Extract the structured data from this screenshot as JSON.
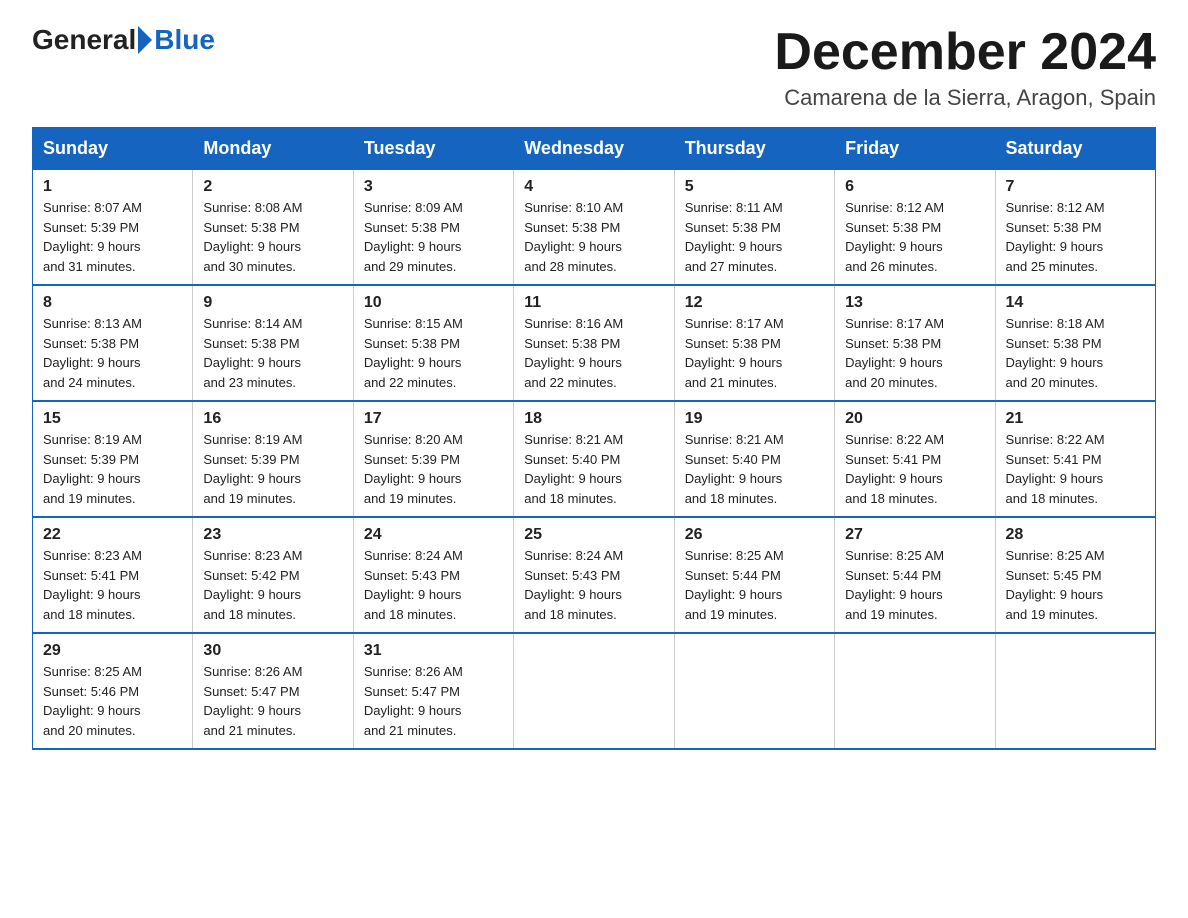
{
  "header": {
    "logo_general": "General",
    "logo_blue": "Blue",
    "month_title": "December 2024",
    "location": "Camarena de la Sierra, Aragon, Spain"
  },
  "weekdays": [
    "Sunday",
    "Monday",
    "Tuesday",
    "Wednesday",
    "Thursday",
    "Friday",
    "Saturday"
  ],
  "weeks": [
    [
      {
        "day": "1",
        "sunrise": "8:07 AM",
        "sunset": "5:39 PM",
        "daylight": "9 hours and 31 minutes."
      },
      {
        "day": "2",
        "sunrise": "8:08 AM",
        "sunset": "5:38 PM",
        "daylight": "9 hours and 30 minutes."
      },
      {
        "day": "3",
        "sunrise": "8:09 AM",
        "sunset": "5:38 PM",
        "daylight": "9 hours and 29 minutes."
      },
      {
        "day": "4",
        "sunrise": "8:10 AM",
        "sunset": "5:38 PM",
        "daylight": "9 hours and 28 minutes."
      },
      {
        "day": "5",
        "sunrise": "8:11 AM",
        "sunset": "5:38 PM",
        "daylight": "9 hours and 27 minutes."
      },
      {
        "day": "6",
        "sunrise": "8:12 AM",
        "sunset": "5:38 PM",
        "daylight": "9 hours and 26 minutes."
      },
      {
        "day": "7",
        "sunrise": "8:12 AM",
        "sunset": "5:38 PM",
        "daylight": "9 hours and 25 minutes."
      }
    ],
    [
      {
        "day": "8",
        "sunrise": "8:13 AM",
        "sunset": "5:38 PM",
        "daylight": "9 hours and 24 minutes."
      },
      {
        "day": "9",
        "sunrise": "8:14 AM",
        "sunset": "5:38 PM",
        "daylight": "9 hours and 23 minutes."
      },
      {
        "day": "10",
        "sunrise": "8:15 AM",
        "sunset": "5:38 PM",
        "daylight": "9 hours and 22 minutes."
      },
      {
        "day": "11",
        "sunrise": "8:16 AM",
        "sunset": "5:38 PM",
        "daylight": "9 hours and 22 minutes."
      },
      {
        "day": "12",
        "sunrise": "8:17 AM",
        "sunset": "5:38 PM",
        "daylight": "9 hours and 21 minutes."
      },
      {
        "day": "13",
        "sunrise": "8:17 AM",
        "sunset": "5:38 PM",
        "daylight": "9 hours and 20 minutes."
      },
      {
        "day": "14",
        "sunrise": "8:18 AM",
        "sunset": "5:38 PM",
        "daylight": "9 hours and 20 minutes."
      }
    ],
    [
      {
        "day": "15",
        "sunrise": "8:19 AM",
        "sunset": "5:39 PM",
        "daylight": "9 hours and 19 minutes."
      },
      {
        "day": "16",
        "sunrise": "8:19 AM",
        "sunset": "5:39 PM",
        "daylight": "9 hours and 19 minutes."
      },
      {
        "day": "17",
        "sunrise": "8:20 AM",
        "sunset": "5:39 PM",
        "daylight": "9 hours and 19 minutes."
      },
      {
        "day": "18",
        "sunrise": "8:21 AM",
        "sunset": "5:40 PM",
        "daylight": "9 hours and 18 minutes."
      },
      {
        "day": "19",
        "sunrise": "8:21 AM",
        "sunset": "5:40 PM",
        "daylight": "9 hours and 18 minutes."
      },
      {
        "day": "20",
        "sunrise": "8:22 AM",
        "sunset": "5:41 PM",
        "daylight": "9 hours and 18 minutes."
      },
      {
        "day": "21",
        "sunrise": "8:22 AM",
        "sunset": "5:41 PM",
        "daylight": "9 hours and 18 minutes."
      }
    ],
    [
      {
        "day": "22",
        "sunrise": "8:23 AM",
        "sunset": "5:41 PM",
        "daylight": "9 hours and 18 minutes."
      },
      {
        "day": "23",
        "sunrise": "8:23 AM",
        "sunset": "5:42 PM",
        "daylight": "9 hours and 18 minutes."
      },
      {
        "day": "24",
        "sunrise": "8:24 AM",
        "sunset": "5:43 PM",
        "daylight": "9 hours and 18 minutes."
      },
      {
        "day": "25",
        "sunrise": "8:24 AM",
        "sunset": "5:43 PM",
        "daylight": "9 hours and 18 minutes."
      },
      {
        "day": "26",
        "sunrise": "8:25 AM",
        "sunset": "5:44 PM",
        "daylight": "9 hours and 19 minutes."
      },
      {
        "day": "27",
        "sunrise": "8:25 AM",
        "sunset": "5:44 PM",
        "daylight": "9 hours and 19 minutes."
      },
      {
        "day": "28",
        "sunrise": "8:25 AM",
        "sunset": "5:45 PM",
        "daylight": "9 hours and 19 minutes."
      }
    ],
    [
      {
        "day": "29",
        "sunrise": "8:25 AM",
        "sunset": "5:46 PM",
        "daylight": "9 hours and 20 minutes."
      },
      {
        "day": "30",
        "sunrise": "8:26 AM",
        "sunset": "5:47 PM",
        "daylight": "9 hours and 21 minutes."
      },
      {
        "day": "31",
        "sunrise": "8:26 AM",
        "sunset": "5:47 PM",
        "daylight": "9 hours and 21 minutes."
      },
      null,
      null,
      null,
      null
    ]
  ]
}
